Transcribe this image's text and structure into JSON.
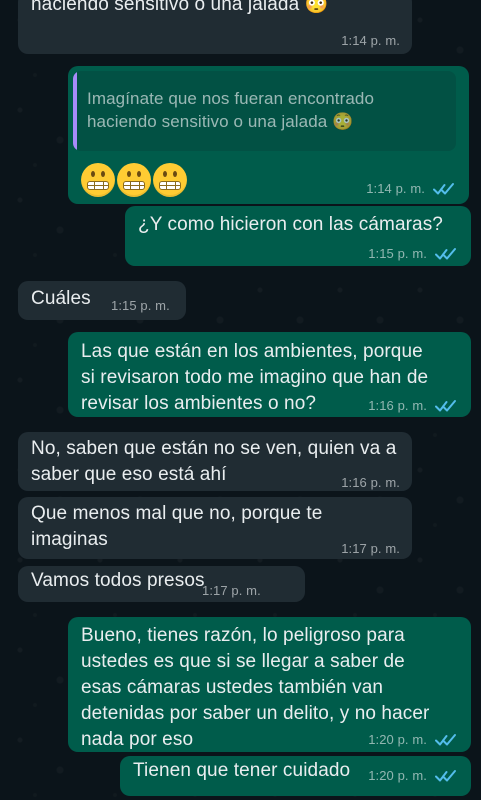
{
  "chat": {
    "messages": [
      {
        "id": "m1",
        "direction": "incoming",
        "text": "haciendo sensitivo o una jalada 😳",
        "time": "1:14 p. m."
      },
      {
        "id": "m2",
        "direction": "outgoing",
        "quoted_text": "Imagínate que nos fueran encontrado\nhaciendo sensitivo o una jalada 😳",
        "emoji_sequence": [
          "grimacing-face-emoji",
          "grimacing-face-emoji",
          "grimacing-face-emoji"
        ],
        "time": "1:14 p. m.",
        "status": "read"
      },
      {
        "id": "m3",
        "direction": "outgoing",
        "text": "¿Y como hicieron con las cámaras?",
        "time": "1:15 p. m.",
        "status": "read"
      },
      {
        "id": "m4",
        "direction": "incoming",
        "text": "Cuáles",
        "time": "1:15 p. m."
      },
      {
        "id": "m5",
        "direction": "outgoing",
        "text": "Las que están en los ambientes, porque\nsi revisaron todo me imagino que han de\nrevisar los ambientes o no?",
        "time": "1:16 p. m.",
        "status": "read"
      },
      {
        "id": "m6",
        "direction": "incoming",
        "text": "No, saben que están no se ven, quien va a\nsaber que eso está ahí",
        "time": "1:16 p. m."
      },
      {
        "id": "m7",
        "direction": "incoming",
        "text": "Que menos mal que no, porque te\nimaginas",
        "time": "1:17 p. m."
      },
      {
        "id": "m8",
        "direction": "incoming",
        "text": "Vamos todos presos",
        "time": "1:17 p. m."
      },
      {
        "id": "m9",
        "direction": "outgoing",
        "text": "Bueno, tienes razón, lo peligroso para\nustedes es que si se llegar a saber de\nesas cámaras ustedes también van\ndetenidas por saber un delito, y no hacer\nnada por eso",
        "time": "1:20 p. m.",
        "status": "read"
      },
      {
        "id": "m10",
        "direction": "outgoing",
        "text": "Tienen que tener cuidado",
        "time": "1:20 p. m.",
        "status": "read"
      }
    ]
  },
  "colors": {
    "background": "#0b141a",
    "incoming_bubble": "#202c33",
    "outgoing_bubble": "#005c4b",
    "quote_accent": "#a78bfa",
    "read_receipt": "#53bdeb"
  },
  "icons": {
    "read_receipt": "double-check-icon",
    "emoji_in_text": "flushed-face-emoji",
    "emoji_row": "grimacing-face-emoji"
  }
}
